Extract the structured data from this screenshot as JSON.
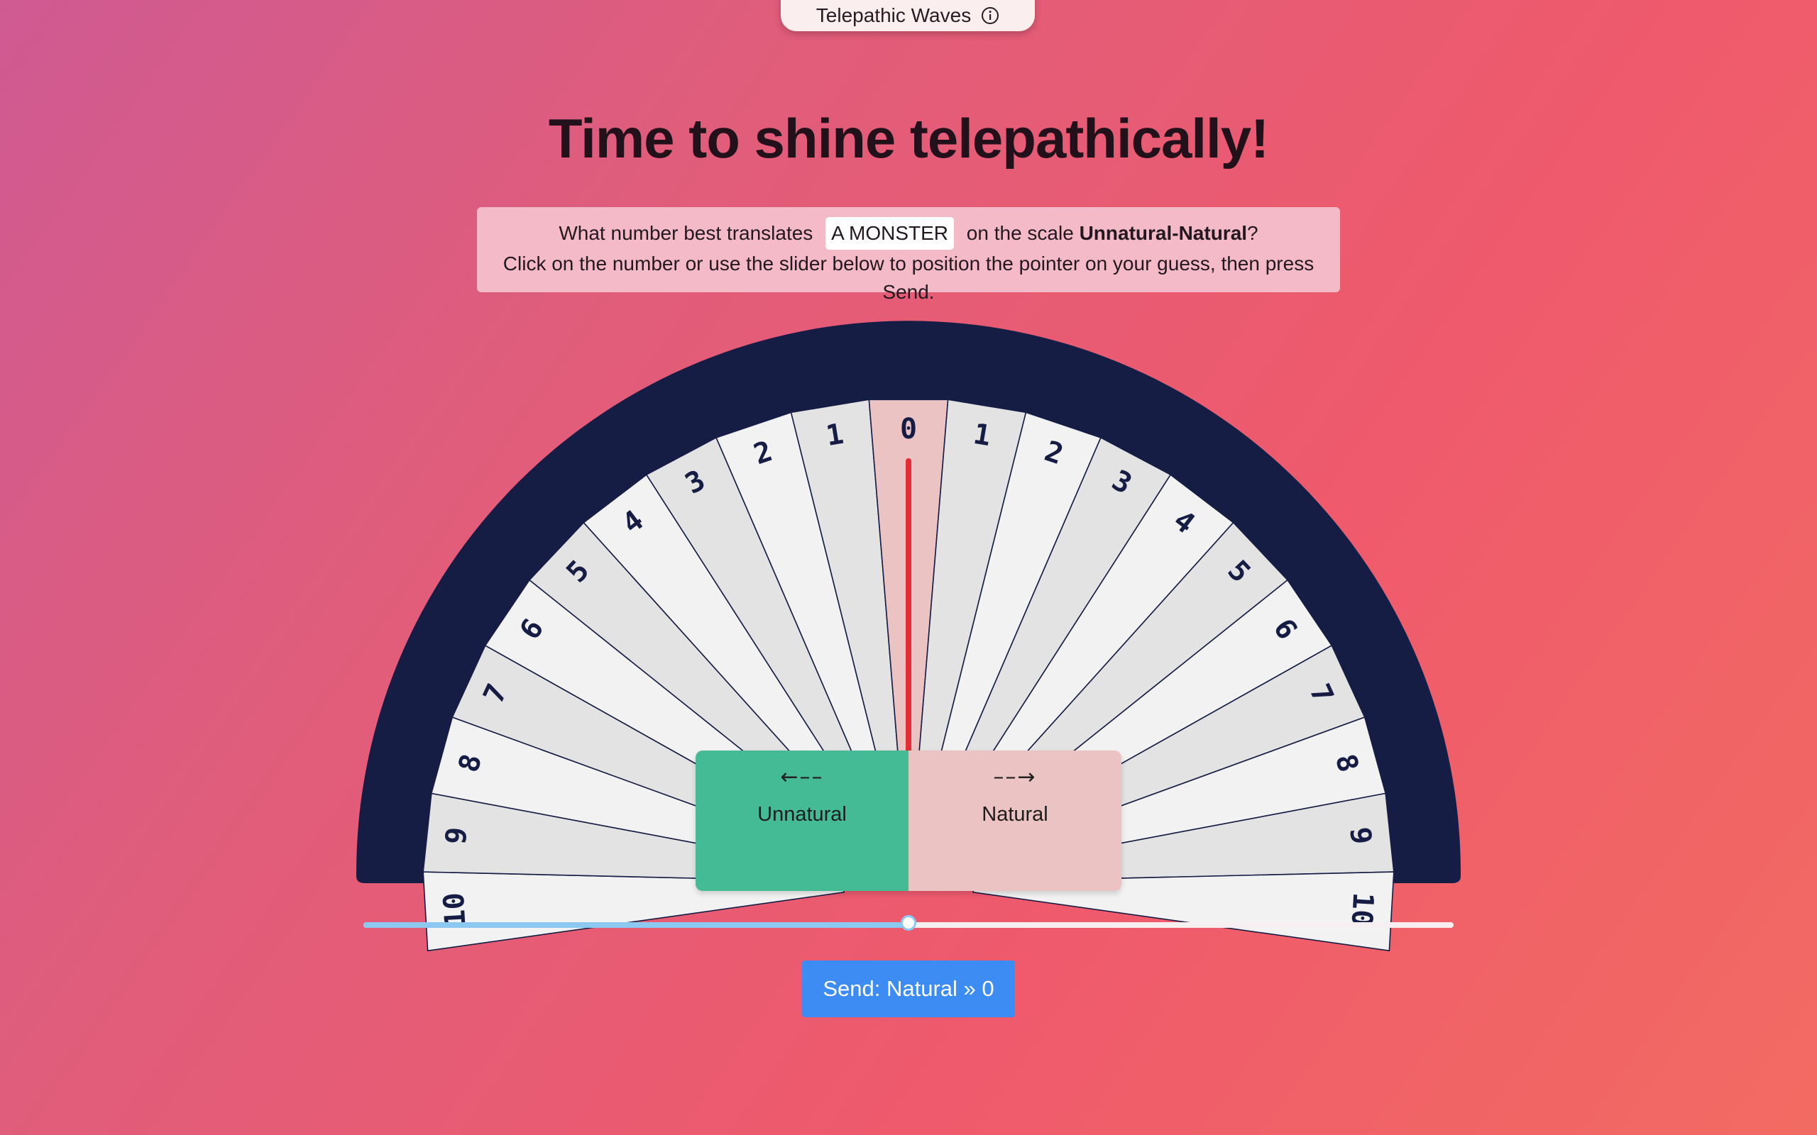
{
  "header": {
    "game_name": "Telepathic Waves",
    "info_icon": "info-icon"
  },
  "title": "Time to shine telepathically!",
  "prompt": {
    "before": "What number best translates",
    "word": "A MONSTER",
    "middle": "on the scale",
    "scale_name": "Unnatural-Natural",
    "after": "?",
    "instruction": "Click on the number or use the slider below to position the pointer on your guess, then press Send."
  },
  "dial": {
    "left_numbers": [
      "10",
      "9",
      "8",
      "7",
      "6",
      "5",
      "4",
      "3",
      "2",
      "1"
    ],
    "center_number": "0",
    "right_numbers": [
      "1",
      "2",
      "3",
      "4",
      "5",
      "6",
      "7",
      "8",
      "9",
      "10"
    ],
    "selected_value": 0,
    "colors": {
      "rim": "#161d45",
      "segment_light": "#f2f2f2",
      "segment_dark": "#e3e3e3",
      "segment_selected": "#ebc3c3",
      "pointer": "#e52b33",
      "number": "#161d45"
    }
  },
  "choices": {
    "left": {
      "arrow": "←––",
      "label": "Unnatural",
      "color": "#44bb94"
    },
    "right": {
      "arrow": "––→",
      "label": "Natural",
      "color": "#ebc3c3"
    }
  },
  "slider": {
    "min": -10,
    "max": 10,
    "value": 0
  },
  "send_button": {
    "label": "Send: Natural » 0"
  }
}
